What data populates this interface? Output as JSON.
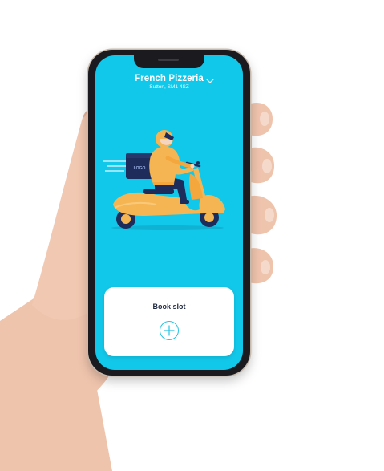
{
  "restaurant": {
    "name": "French Pizzeria",
    "address": "Sutton, SM1 4SZ"
  },
  "illustration": {
    "box_label": "LOGO",
    "subject": "delivery-scooter-rider"
  },
  "booking_card": {
    "title": "Book slot",
    "action_icon": "plus-circle-icon"
  },
  "colors": {
    "screen_background": "#12c8ea",
    "card_background": "#ffffff",
    "accent": "#26c3e0",
    "scooter": "#f6b553",
    "title_text": "#1f2a44"
  }
}
